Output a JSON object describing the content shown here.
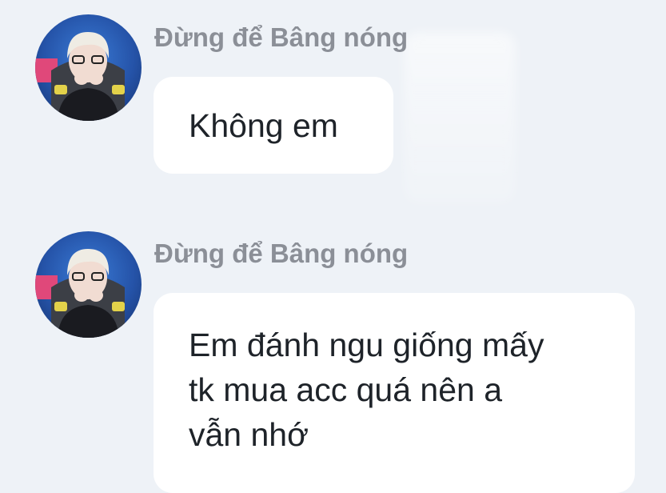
{
  "messages": [
    {
      "sender": "Đừng để Bâng nóng",
      "avatar_icon": "user-avatar",
      "lines": [
        "Không em"
      ]
    },
    {
      "sender": "Đừng để Bâng nóng",
      "avatar_icon": "user-avatar",
      "lines": [
        "Em đánh ngu giống mấy",
        "tk mua acc quá nên a",
        "vẫn nhớ"
      ]
    }
  ],
  "colors": {
    "background": "#eef2f7",
    "bubble": "#ffffff",
    "sender_text": "#8b8f97",
    "message_text": "#1e2329"
  }
}
